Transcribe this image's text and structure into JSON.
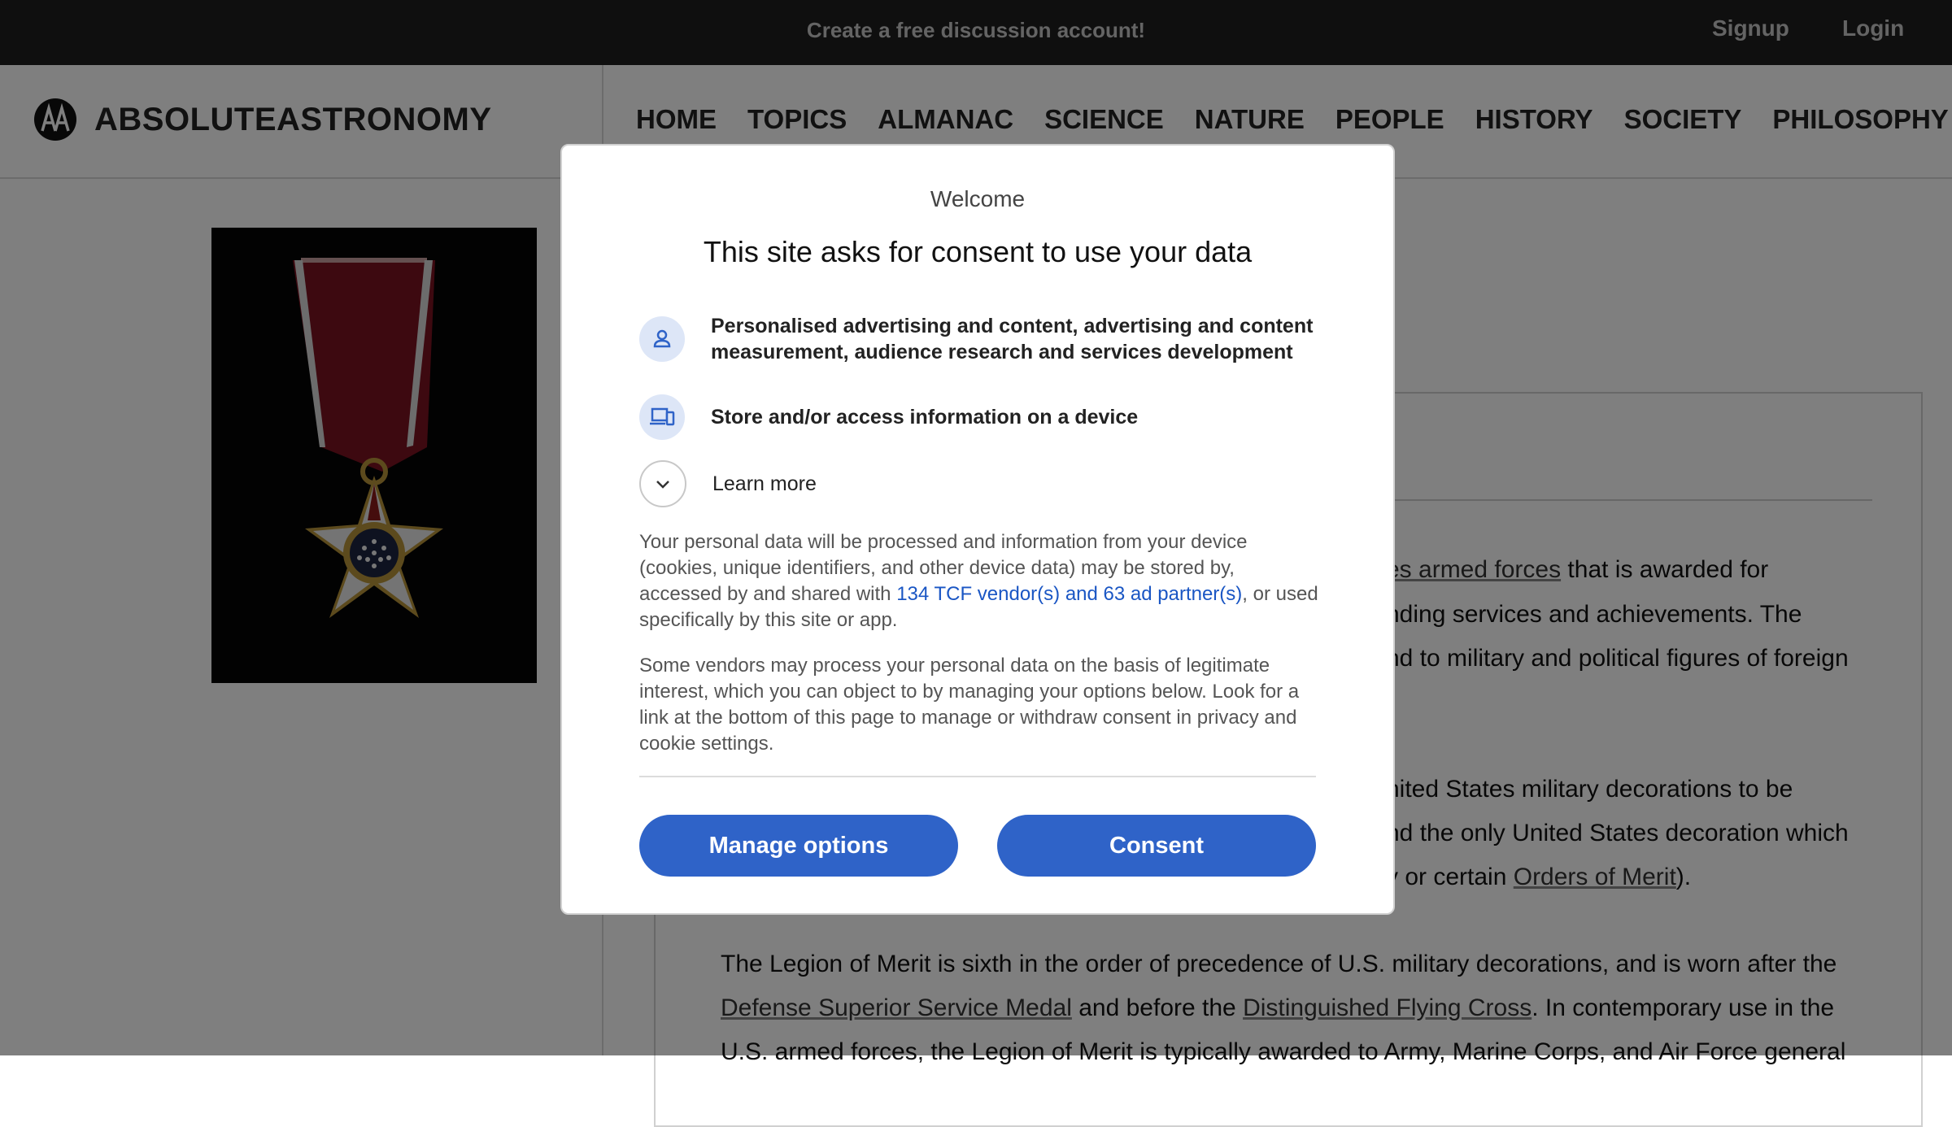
{
  "topbar": {
    "promo": "Create a free discussion account!",
    "signup": "Signup",
    "login": "Login"
  },
  "header": {
    "logo_text": "ABSOLUTEASTRONOMY",
    "nav": [
      "HOME",
      "TOPICS",
      "ALMANAC",
      "SCIENCE",
      "NATURE",
      "PEOPLE",
      "HISTORY",
      "SOCIETY",
      "PHILOSOPHY"
    ]
  },
  "article": {
    "line1_link": "es armed forces",
    "line1_text": " that is awarded for",
    "line2": "nding services and achievements. The",
    "line3": "nd to military and political figures of foreign",
    "line4": "nited States military decorations to be",
    "line5": "nd the only United States decoration which",
    "line6_pre": "y or certain ",
    "line6_link": "Orders of Merit",
    "line6_post": ").",
    "line7": "The Legion of Merit is sixth in the order of precedence of U.S. military decorations, and is worn after the",
    "line8_link1": "Defense Superior Service Medal",
    "line8_mid": " and before the ",
    "line8_link2": "Distinguished Flying Cross",
    "line8_post": ". In contemporary use in the",
    "line9": "U.S. armed forces, the Legion of Merit is typically awarded to Army, Marine Corps, and Air Force general"
  },
  "consent": {
    "welcome": "Welcome",
    "title": "This site asks for consent to use your data",
    "purpose1": "Personalised advertising and content, advertising and content measurement, audience research and services development",
    "purpose2": "Store and/or access information on a device",
    "learn_more": "Learn more",
    "para1_pre": "Your personal data will be processed and information from your device (cookies, unique identifiers, and other device data) may be stored by, accessed by and shared with ",
    "para1_link": "134 TCF vendor(s) and 63 ad partner(s)",
    "para1_post": ", or used specifically by this site or app.",
    "para2": "Some vendors may process your personal data on the basis of legitimate interest, which you can object to by managing your options below. Look for a link at the bottom of this page to manage or withdraw consent in privacy and cookie settings.",
    "manage_button": "Manage options",
    "consent_button": "Consent",
    "icons": [
      "person-icon",
      "devices-icon",
      "chevron-down-icon"
    ],
    "accent_color": "#2f63c8"
  }
}
